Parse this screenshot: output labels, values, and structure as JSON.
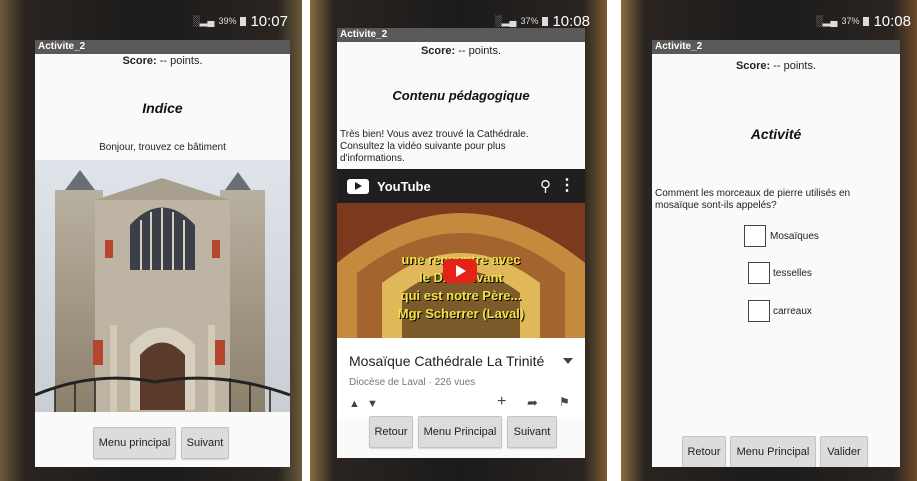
{
  "screens": [
    {
      "status": {
        "signal": "░▂▄",
        "battery_pct": "39%",
        "time": "10:07"
      },
      "app_title": "Activite_2",
      "score_label": "Score:",
      "score_value": " -- points.",
      "heading": "Indice",
      "text": "Bonjour, trouvez ce bâtiment",
      "buttons": [
        "Menu principal",
        "Suivant"
      ]
    },
    {
      "status": {
        "signal": "░▂▄",
        "battery_pct": "37%",
        "time": "10:08"
      },
      "app_title": "Activite_2",
      "score_label": "Score:",
      "score_value": " -- points.",
      "heading": "Contenu pédagogique",
      "text": "Très bien! Vous avez trouvé la Cathédrale. Consultez la vidéo suivante pour plus d'informations.",
      "youtube": {
        "brand": "YouTube",
        "video_overlay": [
          "une rencontre avec",
          "le Dieu vivant",
          "qui est notre Père...",
          "Mgr Scherrer (Laval)"
        ],
        "video_title": "Mosaïque Cathédrale La Trinité",
        "channel": "Diocèse de Laval",
        "views": "226 vues"
      },
      "buttons": [
        "Retour",
        "Menu Principal",
        "Suivant"
      ]
    },
    {
      "status": {
        "signal": "░▂▄",
        "battery_pct": "37%",
        "time": "10:08"
      },
      "app_title": "Activite_2",
      "score_label": "Score:",
      "score_value": " -- points.",
      "heading": "Activité",
      "question": "Comment les morceaux de pierre utilisés en mosaïque sont-ils appelés?",
      "options": [
        "Mosaïques",
        "tesselles",
        "carreaux"
      ],
      "buttons": [
        "Retour",
        "Menu Principal",
        "Valider"
      ]
    }
  ]
}
